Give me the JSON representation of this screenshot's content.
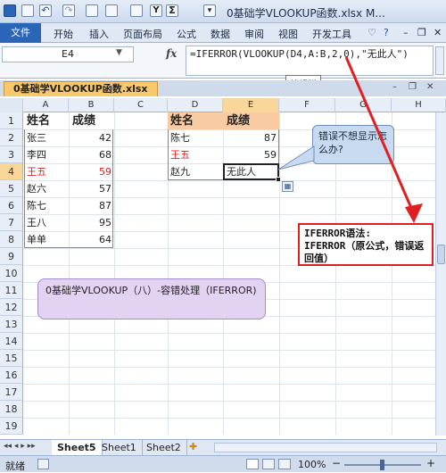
{
  "title_bar": {
    "title": "0基础学VLOOKUP函数.xlsx M..."
  },
  "ribbon": {
    "file": "文件",
    "tabs": [
      "开始",
      "插入",
      "页面布局",
      "公式",
      "数据",
      "审阅",
      "视图",
      "开发工具"
    ]
  },
  "formula_bar": {
    "name_box": "E4",
    "fx": "fx",
    "formula": "=IFERROR(VLOOKUP(D4,A:B,2,0),\"无此人\")",
    "tooltip": "编辑栏"
  },
  "workbook_tab": "0基础学VLOOKUP函数.xlsx",
  "columns": [
    "A",
    "B",
    "C",
    "D",
    "E",
    "F",
    "G",
    "H"
  ],
  "rows": [
    "1",
    "2",
    "3",
    "4",
    "5",
    "6",
    "7",
    "8",
    "9",
    "10",
    "11",
    "12",
    "13",
    "14",
    "15",
    "16",
    "17",
    "18",
    "19"
  ],
  "table_left": {
    "headers": [
      "姓名",
      "成绩"
    ],
    "rows": [
      {
        "name": "张三",
        "score": "42"
      },
      {
        "name": "李四",
        "score": "68"
      },
      {
        "name": "王五",
        "score": "59"
      },
      {
        "name": "赵六",
        "score": "57"
      },
      {
        "name": "陈七",
        "score": "87"
      },
      {
        "name": "王八",
        "score": "95"
      },
      {
        "name": "单单",
        "score": "64"
      }
    ]
  },
  "table_right": {
    "headers": [
      "姓名",
      "成绩"
    ],
    "rows": [
      {
        "name": "陈七",
        "score": "87"
      },
      {
        "name": "王五",
        "score": "59"
      },
      {
        "name": "赵九",
        "score": "无此人"
      }
    ]
  },
  "callouts": {
    "question": "错误不想显示怎么办?",
    "syntax_title": "IFERROR语法:",
    "syntax_body": "IFERROR（原公式，错误返回值）",
    "topic": "0基础学VLOOKUP（八）-容错处理（IFERROR)"
  },
  "sheets": [
    "Sheet5",
    "Sheet1",
    "Sheet2"
  ],
  "status": {
    "ready": "就绪",
    "zoom": "100%"
  },
  "colors": {
    "accent": "#2a65b7",
    "highlight_red": "#e02020",
    "header_fill": "#f8cba2"
  }
}
